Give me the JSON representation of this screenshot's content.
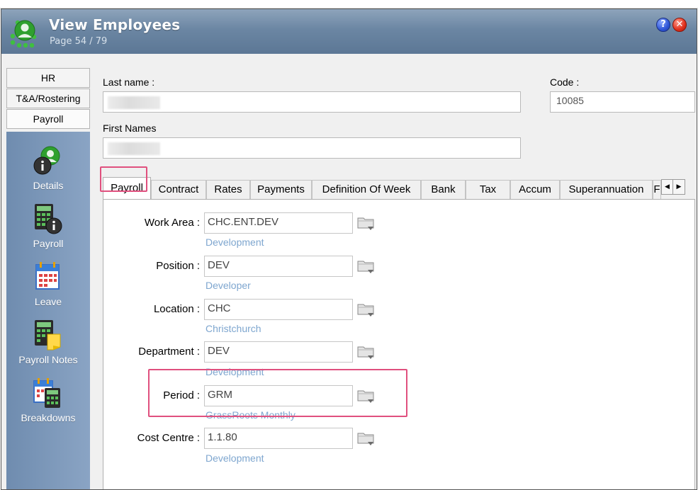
{
  "window": {
    "title": "View Employees",
    "subtitle": "Page 54 / 79",
    "help_glyph": "?",
    "close_glyph": "✕"
  },
  "nav_tabs": [
    {
      "label": "HR"
    },
    {
      "label": "T&A/Rostering"
    },
    {
      "label": "Payroll"
    }
  ],
  "nav_items": [
    {
      "label": "Details",
      "icon": "employee-details-icon"
    },
    {
      "label": "Payroll",
      "icon": "calculator-info-icon"
    },
    {
      "label": "Leave",
      "icon": "calendar-icon"
    },
    {
      "label": "Payroll Notes",
      "icon": "calculator-note-icon"
    },
    {
      "label": "Breakdowns",
      "icon": "calendar-calculator-icon"
    }
  ],
  "employee": {
    "last_name_label": "Last name :",
    "code_label": "Code :",
    "code_value": "10085",
    "first_names_label": "First Names"
  },
  "tabs": [
    {
      "label": "Payroll",
      "active": true
    },
    {
      "label": "Contract"
    },
    {
      "label": "Rates"
    },
    {
      "label": "Payments"
    },
    {
      "label": "Definition Of Week"
    },
    {
      "label": "Bank"
    },
    {
      "label": "Tax"
    },
    {
      "label": "Accum"
    },
    {
      "label": "Superannuation"
    },
    {
      "label": "F"
    }
  ],
  "tab_scroll": {
    "left": "◀",
    "right": "▶"
  },
  "payroll": {
    "rows": [
      {
        "label": "Work Area :",
        "value": "CHC.ENT.DEV",
        "description": "Development"
      },
      {
        "label": "Position :",
        "value": "DEV",
        "description": "Developer"
      },
      {
        "label": "Location :",
        "value": "CHC",
        "description": "Christchurch"
      },
      {
        "label": "Department :",
        "value": "DEV",
        "description": "Development"
      },
      {
        "label": "Period :",
        "value": "GRM",
        "description": "GrassRoots Monthly"
      },
      {
        "label": "Cost Centre :",
        "value": "1.1.80",
        "description": "Development"
      }
    ]
  },
  "colors": {
    "titlebar": "#6b86a3",
    "nav_panel": "#7d97b8",
    "highlight": "#e0507e",
    "description_text": "#7ea6cf"
  }
}
